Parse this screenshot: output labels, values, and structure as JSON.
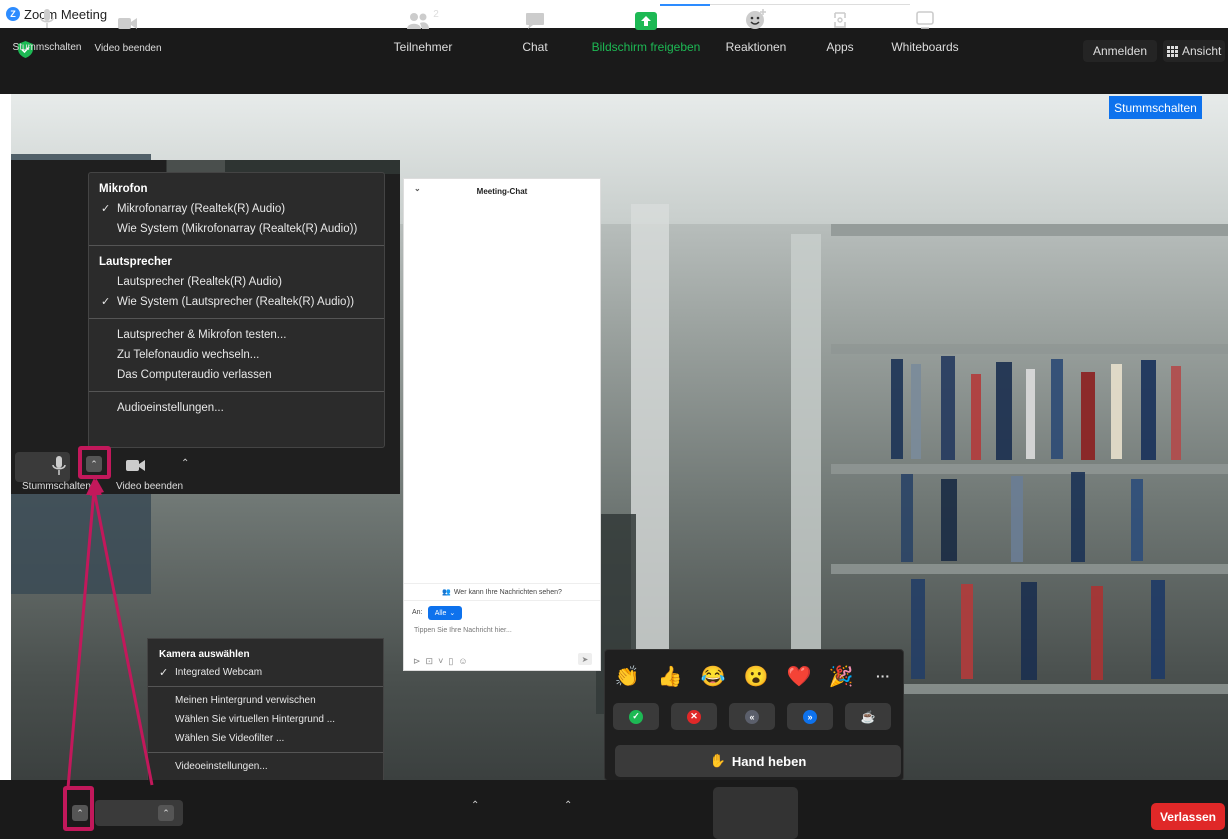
{
  "window": {
    "title": "Zoom Meeting"
  },
  "topbar": {
    "signin_label": "Anmelden",
    "view_label": "Ansicht"
  },
  "video": {
    "mute_all_label": "Stummschalten"
  },
  "audio_menu": {
    "mic_header": "Mikrofon",
    "mic_items": [
      {
        "label": "Mikrofonarray (Realtek(R) Audio)",
        "checked": true
      },
      {
        "label": "Wie System (Mikrofonarray (Realtek(R) Audio))",
        "checked": false
      }
    ],
    "speaker_header": "Lautsprecher",
    "speaker_items": [
      {
        "label": "Lautsprecher (Realtek(R) Audio)",
        "checked": false
      },
      {
        "label": "Wie System (Lautsprecher (Realtek(R) Audio))",
        "checked": true
      }
    ],
    "actions": [
      "Lautsprecher & Mikrofon testen...",
      "Zu Telefonaudio wechseln...",
      "Das Computeraudio verlassen"
    ],
    "settings_label": "Audioeinstellungen...",
    "check_mark": "✓"
  },
  "audio_bar": {
    "mute_label": "Stummschalten",
    "video_label": "Video beenden"
  },
  "chat": {
    "header": "Meeting-Chat",
    "who_can_see": "Wer kann Ihre Nachrichten sehen?",
    "to_label": "An:",
    "recipient": "Alle",
    "placeholder": "Tippen Sie Ihre Nachricht hier..."
  },
  "camera_menu": {
    "header": "Kamera auswählen",
    "camera": "Integrated Webcam",
    "options": [
      "Meinen Hintergrund verwischen",
      "Wählen Sie virtuellen Hintergrund ...",
      "Wählen Sie Videofilter ..."
    ],
    "settings_label": "Videoeinstellungen...",
    "check_mark": "✓"
  },
  "reactions": {
    "emojis": [
      "👏",
      "👍",
      "😂",
      "😮",
      "❤️",
      "🎉"
    ],
    "more": "···",
    "status_buttons": [
      {
        "name": "yes",
        "symbol": "✓",
        "color": "#1DB954"
      },
      {
        "name": "no",
        "symbol": "✕",
        "color": "#E02828"
      },
      {
        "name": "slower",
        "symbol": "«",
        "color": "#5b5f6b"
      },
      {
        "name": "faster",
        "symbol": "»",
        "color": "#0E72ED"
      },
      {
        "name": "coffee",
        "symbol": "☕",
        "color": "#3a3a3a"
      }
    ],
    "raise_hand": "Hand heben",
    "hand_emoji": "✋"
  },
  "toolbar": {
    "mute_label": "Stummschalten",
    "video_label": "Video beenden",
    "participants_label": "Teilnehmer",
    "participants_count": "2",
    "chat_label": "Chat",
    "share_label": "Bildschirm freigeben",
    "reactions_label": "Reaktionen",
    "apps_label": "Apps",
    "whiteboards_label": "Whiteboards",
    "leave_label": "Verlassen"
  },
  "colors": {
    "accent": "#0E72ED",
    "leave": "#E02828",
    "highlight": "#C2185B",
    "share": "#1DB954"
  }
}
